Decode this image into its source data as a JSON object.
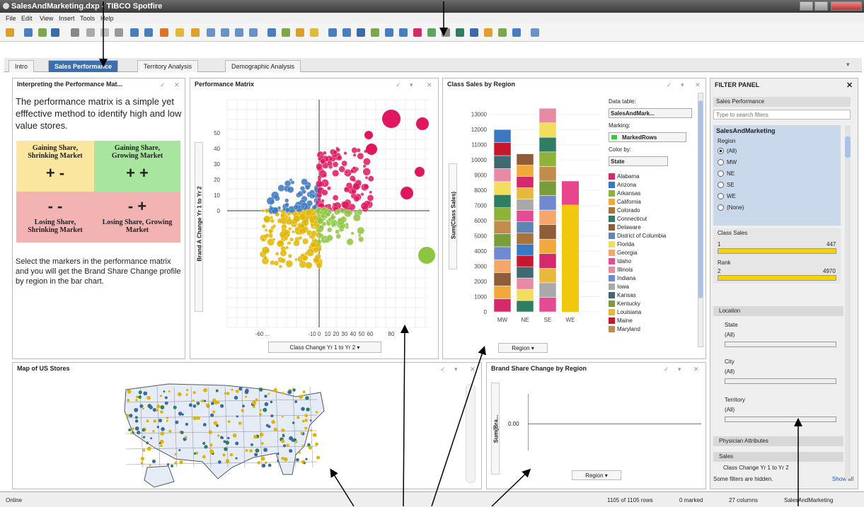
{
  "window": {
    "title": "SalesAndMarketing.dxp - TIBCO Spotfire"
  },
  "menu": [
    "File",
    "Edit",
    "View",
    "Insert",
    "Tools",
    "Help"
  ],
  "tabs": [
    "Intro",
    "Sales Performance",
    "Territory Analysis",
    "Demographic Analysis"
  ],
  "interpreting": {
    "title": "Interpreting the Performance Mat...",
    "intro": "The performance matrix is a simple yet efffective method to identify high and low value stores.",
    "q1": "Gaining Share, Shrinking Market",
    "q1s": "+ -",
    "q2": "Gaining Share, Growing Market",
    "q2s": "+ +",
    "q3": "Losing Share, Shrinking Market",
    "q3s": "- -",
    "q4": "Losing Share, Growing Market",
    "q4s": "- +",
    "outro": "Select the markers  in the performance matrix and you will get the Brand Share Change profile by region in the bar chart."
  },
  "matrix": {
    "title": "Performance Matrix",
    "ylabel": "Brand A Change Yr 1 to Yr 2",
    "xlabel": "Class Change Yr 1 to Yr 2",
    "yticks": [
      "50",
      "40",
      "30",
      "20",
      "10",
      "0"
    ],
    "xticks": [
      "-60 ...",
      "-10",
      "0",
      "10",
      "20",
      "30",
      "40",
      "50",
      "60",
      "80"
    ]
  },
  "classSales": {
    "title": "Class Sales by Region",
    "ylabel": "Sum(Class Sales)",
    "xlabel": "Region",
    "categories": [
      "MW",
      "NE",
      "SE",
      "WE"
    ],
    "yticks": [
      "13000",
      "12000",
      "11000",
      "10000",
      "9000",
      "8000",
      "7000",
      "6000",
      "5000",
      "4000",
      "3000",
      "2000",
      "1000",
      "0"
    ],
    "datatable_label": "Data table:",
    "datatable": "SalesAndMark...",
    "marking_label": "Marking:",
    "marking": "MarkedRows",
    "colorby_label": "Color by:",
    "colorby": "State",
    "legend": [
      "Alabama",
      "Arizona",
      "Arkansas",
      "California",
      "Colorado",
      "Connecticut",
      "Delaware",
      "District of Columbia",
      "Florida",
      "Georgia",
      "Idaho",
      "Illinois",
      "Indiana",
      "Iowa",
      "Kansas",
      "Kentucky",
      "Louisiana",
      "Maine",
      "Maryland"
    ],
    "legendColors": [
      "#d6296b",
      "#3a78c2",
      "#8fb33a",
      "#f2a93b",
      "#a8743c",
      "#2f7d62",
      "#8f5d3a",
      "#5e84b4",
      "#f3dd5c",
      "#f5a66b",
      "#e34c93",
      "#e88aa3",
      "#6f8ad0",
      "#a9a9a9",
      "#3f6a73",
      "#7a9d3c",
      "#e8b83d",
      "#c7172d",
      "#c28c4c"
    ]
  },
  "chart_data": {
    "type": "bar",
    "categories": [
      "MW",
      "NE",
      "SE",
      "WE"
    ],
    "values": [
      12000,
      10400,
      13400,
      8600
    ],
    "title": "Class Sales by Region",
    "xlabel": "Region",
    "ylabel": "Sum(Class Sales)",
    "ylim": [
      0,
      13500
    ]
  },
  "map": {
    "title": "Map of US Stores"
  },
  "brand": {
    "title": "Brand Share Change by Region",
    "ylabel": "Sum(Bra...",
    "ytick": "0.00",
    "xlabel": "Region"
  },
  "filter": {
    "title": "FILTER PANEL",
    "page": "Sales Performance",
    "search_placeholder": "Type to search filters",
    "table": "SalesAndMarketing",
    "region_label": "Region",
    "regions": [
      "(All)",
      "MW",
      "NE",
      "SE",
      "WE",
      "(None)"
    ],
    "classSales_label": "Class Sales",
    "classSales_min": "1",
    "classSales_max": "447",
    "rank_label": "Rank",
    "rank_min": "2",
    "rank_max": "4970",
    "location": "Location",
    "state": "State",
    "state_val": "(All)",
    "city": "City",
    "city_val": "(All)",
    "territory": "Territory",
    "territory_val": "(All)",
    "physicians": "Physician Attributes",
    "sales": "Sales",
    "classChange": "Class Change Yr 1 to Yr 2",
    "hidden": "Some filters are hidden.",
    "showall": "Show all"
  },
  "status": {
    "left": "Online",
    "rows": "1105 of 1105 rows",
    "marked": "0 marked",
    "columns": "27 columns",
    "table": "SalesAndMarketing"
  }
}
